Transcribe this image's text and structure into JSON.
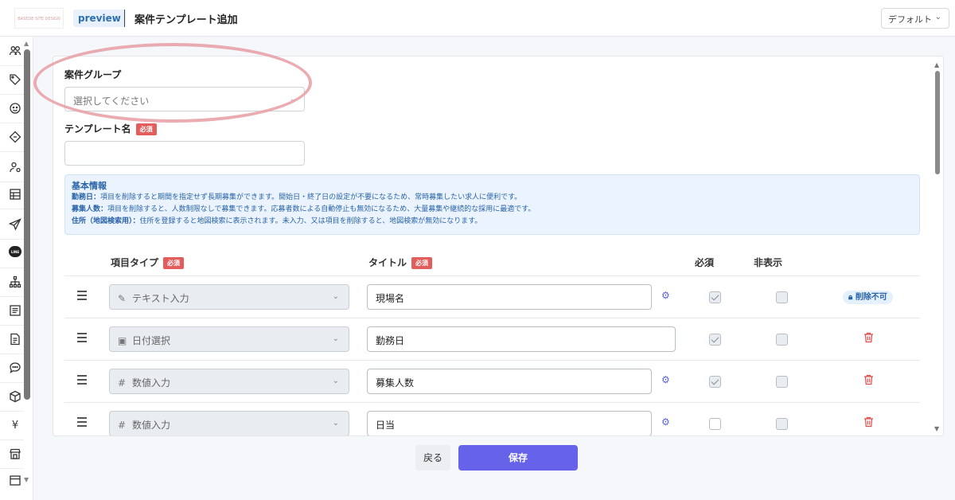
{
  "header": {
    "logo_text": "BASEDE SITE DESIGN",
    "badge": "preview",
    "title": "案件テンプレート追加",
    "layout_select": "デフォルト"
  },
  "sidebar": {
    "items": [
      {
        "icon": "users-icon"
      },
      {
        "icon": "tags-icon"
      },
      {
        "icon": "smile-icon"
      },
      {
        "icon": "ticket-icon"
      },
      {
        "icon": "user-settings-icon"
      },
      {
        "icon": "list-icon"
      },
      {
        "icon": "send-icon"
      },
      {
        "icon": "line-icon",
        "label": "LINE"
      },
      {
        "icon": "hierarchy-icon"
      },
      {
        "icon": "article-icon"
      },
      {
        "icon": "document-icon"
      },
      {
        "icon": "chat-icon"
      },
      {
        "icon": "box-icon"
      },
      {
        "icon": "yen-icon",
        "label": "¥"
      },
      {
        "icon": "store-icon"
      },
      {
        "icon": "calendar-icon"
      }
    ]
  },
  "form": {
    "group_label": "案件グループ",
    "group_placeholder": "選択してください",
    "template_name_label": "テンプレート名",
    "required_label": "必須",
    "template_name_value": ""
  },
  "info": {
    "title": "基本情報",
    "lines": [
      {
        "key": "勤務日：",
        "text": "項目を削除すると期間を指定せず長期募集ができます。開始日・終了日の設定が不要になるため、常時募集したい求人に便利です。"
      },
      {
        "key": "募集人数：",
        "text": "項目を削除すると、人数制限なしで募集できます。応募者数による自動停止も無効になるため、大量募集や継続的な採用に最適です。"
      },
      {
        "key": "住所（地図検索用）：",
        "text": "住所を登録すると地図検索に表示されます。未入力、又は項目を削除すると、地図検索が無効になります。"
      }
    ]
  },
  "table": {
    "headers": {
      "type": "項目タイプ",
      "title": "タイトル",
      "required": "必須",
      "hidden": "非表示"
    },
    "rows": [
      {
        "type": "テキスト入力",
        "type_icon": "pencil-icon",
        "title": "現場名",
        "has_gear": true,
        "required": true,
        "hidden": false,
        "action": "削除不可"
      },
      {
        "type": "日付選択",
        "type_icon": "calendar-icon",
        "title": "勤務日",
        "has_gear": false,
        "required": true,
        "hidden": false,
        "action": "trash"
      },
      {
        "type": "数値入力",
        "type_icon": "hash-icon",
        "title": "募集人数",
        "has_gear": true,
        "required": true,
        "hidden": false,
        "action": "trash"
      },
      {
        "type": "数値入力",
        "type_icon": "hash-icon",
        "title": "日当",
        "has_gear": true,
        "required": false,
        "hidden": false,
        "action": "trash"
      }
    ],
    "lock_label": "削除不可"
  },
  "footer": {
    "back_label": "戻る",
    "save_label": "保存"
  },
  "colors": {
    "primary": "#6663ea",
    "required_badge": "#e35d5d",
    "info_bg": "#eaf3fe",
    "info_text": "#2a64a8",
    "highlight_oval": "#e8a2a8",
    "delete": "#e04a4a"
  }
}
